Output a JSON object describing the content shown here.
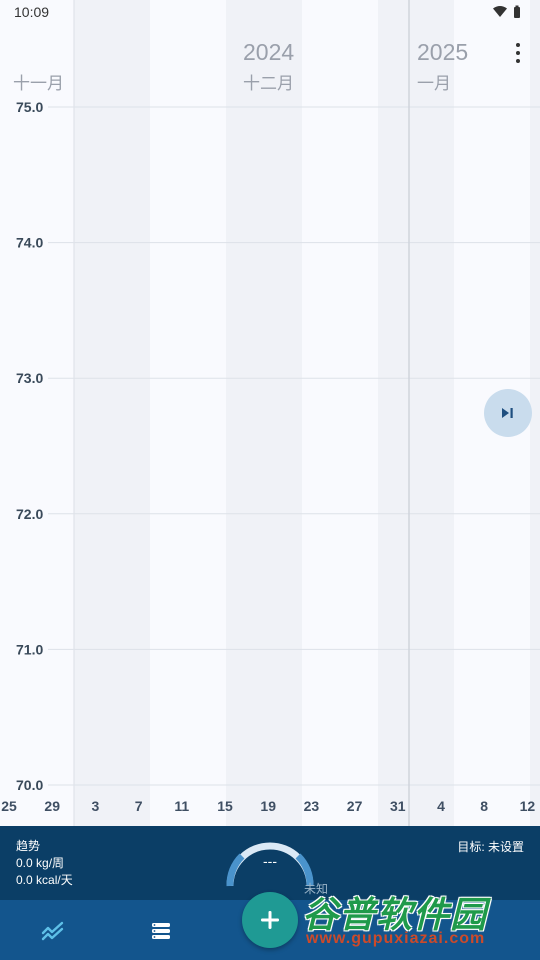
{
  "status_bar": {
    "time": "10:09"
  },
  "header": {
    "years": [
      "2024",
      "2025"
    ],
    "months": [
      "十一月",
      "十二月",
      "一月"
    ]
  },
  "chart_data": {
    "type": "line",
    "title": "",
    "xlabel": "",
    "ylabel": "",
    "y_ticks": [
      "75.0",
      "74.0",
      "73.0",
      "72.0",
      "71.0",
      "70.0"
    ],
    "ylim": [
      70.0,
      75.0
    ],
    "x_ticks": [
      "25",
      "29",
      "3",
      "7",
      "11",
      "15",
      "19",
      "23",
      "27",
      "31",
      "4",
      "8",
      "12"
    ],
    "series": [],
    "grid": true
  },
  "summary": {
    "trend_label": "趋势",
    "weight_rate": "0.0 kg/周",
    "energy_rate": "0.0 kcal/天",
    "gauge_value": "---",
    "goal_label": "目标: 未设置",
    "goal_status": "未知"
  },
  "watermark": {
    "text": "谷普软件园",
    "url": "www.gupuxiazai.com"
  },
  "colors": {
    "accent": "#1f9a94",
    "summary_bg": "#0b3e66",
    "nav_bg": "#13558d"
  }
}
